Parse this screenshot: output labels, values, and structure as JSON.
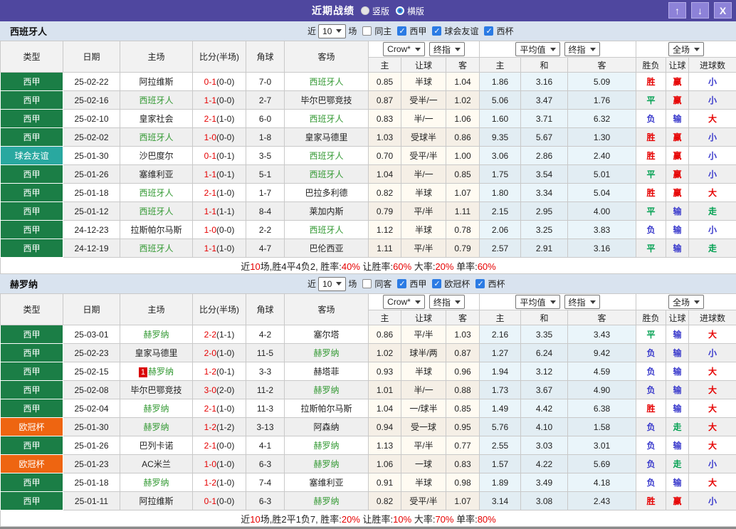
{
  "titlebar": {
    "title": "近期战绩",
    "radio_vertical": {
      "label": "竖版",
      "selected": true
    },
    "radio_horizontal": {
      "label": "横版",
      "selected": false
    },
    "icons": {
      "up": "↑",
      "down": "↓",
      "close": "X"
    }
  },
  "columns": {
    "type": "类型",
    "date": "日期",
    "home": "主场",
    "score": "比分(半场)",
    "corner": "角球",
    "away": "客场",
    "crow_home": "主",
    "crow_handicap": "让球",
    "crow_away": "客",
    "avg_home": "主",
    "avg_draw": "和",
    "avg_away": "客",
    "result": "胜负",
    "handicap_result": "让球",
    "goals": "进球数"
  },
  "dropdowns": {
    "bookmaker": "Crow*",
    "final_index": "终指",
    "average": "平均值",
    "fulltime": "全场"
  },
  "filter_labels": {
    "near": "近",
    "matches": "场"
  },
  "tables": [
    {
      "team": "西班牙人",
      "filter": {
        "count": "10",
        "same": {
          "label": "同主",
          "checked": false
        },
        "leagues": [
          {
            "label": "西甲",
            "checked": true
          },
          {
            "label": "球会友谊",
            "checked": true
          },
          {
            "label": "西杯",
            "checked": true
          }
        ]
      },
      "rows": [
        {
          "type": "西甲",
          "tc": "green",
          "date": "25-02-22",
          "home": "阿拉维斯",
          "hg": false,
          "hb": "",
          "score": "0-1",
          "half": "(0-0)",
          "corner": "7-0",
          "away": "西班牙人",
          "ag": true,
          "crow": [
            "0.85",
            "半球",
            "1.04"
          ],
          "avg": [
            "1.86",
            "3.16",
            "5.09"
          ],
          "res": [
            [
              "胜",
              "r"
            ],
            [
              "赢",
              "r"
            ],
            [
              "小",
              "b"
            ]
          ]
        },
        {
          "type": "西甲",
          "tc": "green",
          "date": "25-02-16",
          "home": "西班牙人",
          "hg": true,
          "hb": "",
          "score": "1-1",
          "half": "(0-0)",
          "corner": "2-7",
          "away": "毕尔巴鄂竞技",
          "ag": false,
          "crow": [
            "0.87",
            "受半/一",
            "1.02"
          ],
          "avg": [
            "5.06",
            "3.47",
            "1.76"
          ],
          "res": [
            [
              "平",
              "g"
            ],
            [
              "赢",
              "r"
            ],
            [
              "小",
              "b"
            ]
          ]
        },
        {
          "type": "西甲",
          "tc": "green",
          "date": "25-02-10",
          "home": "皇家社会",
          "hg": false,
          "hb": "",
          "score": "2-1",
          "half": "(1-0)",
          "corner": "6-0",
          "away": "西班牙人",
          "ag": true,
          "crow": [
            "0.83",
            "半/一",
            "1.06"
          ],
          "avg": [
            "1.60",
            "3.71",
            "6.32"
          ],
          "res": [
            [
              "负",
              "b"
            ],
            [
              "输",
              "b"
            ],
            [
              "大",
              "r"
            ]
          ]
        },
        {
          "type": "西甲",
          "tc": "green",
          "date": "25-02-02",
          "home": "西班牙人",
          "hg": true,
          "hb": "",
          "score": "1-0",
          "half": "(0-0)",
          "corner": "1-8",
          "away": "皇家马德里",
          "ag": false,
          "crow": [
            "1.03",
            "受球半",
            "0.86"
          ],
          "avg": [
            "9.35",
            "5.67",
            "1.30"
          ],
          "res": [
            [
              "胜",
              "r"
            ],
            [
              "赢",
              "r"
            ],
            [
              "小",
              "b"
            ]
          ]
        },
        {
          "type": "球会友谊",
          "tc": "teal",
          "date": "25-01-30",
          "home": "沙巴度尔",
          "hg": false,
          "hb": "",
          "score": "0-1",
          "half": "(0-1)",
          "corner": "3-5",
          "away": "西班牙人",
          "ag": true,
          "crow": [
            "0.70",
            "受平/半",
            "1.00"
          ],
          "avg": [
            "3.06",
            "2.86",
            "2.40"
          ],
          "res": [
            [
              "胜",
              "r"
            ],
            [
              "赢",
              "r"
            ],
            [
              "小",
              "b"
            ]
          ]
        },
        {
          "type": "西甲",
          "tc": "green",
          "date": "25-01-26",
          "home": "塞维利亚",
          "hg": false,
          "hb": "",
          "score": "1-1",
          "half": "(0-1)",
          "corner": "5-1",
          "away": "西班牙人",
          "ag": true,
          "crow": [
            "1.04",
            "半/一",
            "0.85"
          ],
          "avg": [
            "1.75",
            "3.54",
            "5.01"
          ],
          "res": [
            [
              "平",
              "g"
            ],
            [
              "赢",
              "r"
            ],
            [
              "小",
              "b"
            ]
          ]
        },
        {
          "type": "西甲",
          "tc": "green",
          "date": "25-01-18",
          "home": "西班牙人",
          "hg": true,
          "hb": "",
          "score": "2-1",
          "half": "(1-0)",
          "corner": "1-7",
          "away": "巴拉多利德",
          "ag": false,
          "crow": [
            "0.82",
            "半球",
            "1.07"
          ],
          "avg": [
            "1.80",
            "3.34",
            "5.04"
          ],
          "res": [
            [
              "胜",
              "r"
            ],
            [
              "赢",
              "r"
            ],
            [
              "大",
              "r"
            ]
          ]
        },
        {
          "type": "西甲",
          "tc": "green",
          "date": "25-01-12",
          "home": "西班牙人",
          "hg": true,
          "hb": "",
          "score": "1-1",
          "half": "(1-1)",
          "corner": "8-4",
          "away": "莱加内斯",
          "ag": false,
          "crow": [
            "0.79",
            "平/半",
            "1.11"
          ],
          "avg": [
            "2.15",
            "2.95",
            "4.00"
          ],
          "res": [
            [
              "平",
              "g"
            ],
            [
              "输",
              "b"
            ],
            [
              "走",
              "g"
            ]
          ]
        },
        {
          "type": "西甲",
          "tc": "green",
          "date": "24-12-23",
          "home": "拉斯帕尔马斯",
          "hg": false,
          "hb": "",
          "score": "1-0",
          "half": "(0-0)",
          "corner": "2-2",
          "away": "西班牙人",
          "ag": true,
          "crow": [
            "1.12",
            "半球",
            "0.78"
          ],
          "avg": [
            "2.06",
            "3.25",
            "3.83"
          ],
          "res": [
            [
              "负",
              "b"
            ],
            [
              "输",
              "b"
            ],
            [
              "小",
              "b"
            ]
          ]
        },
        {
          "type": "西甲",
          "tc": "green",
          "date": "24-12-19",
          "home": "西班牙人",
          "hg": true,
          "hb": "",
          "score": "1-1",
          "half": "(1-0)",
          "corner": "4-7",
          "away": "巴伦西亚",
          "ag": false,
          "crow": [
            "1.11",
            "平/半",
            "0.79"
          ],
          "avg": [
            "2.57",
            "2.91",
            "3.16"
          ],
          "res": [
            [
              "平",
              "g"
            ],
            [
              "输",
              "b"
            ],
            [
              "走",
              "g"
            ]
          ]
        }
      ],
      "summary": [
        [
          "近",
          "k"
        ],
        [
          "10",
          "r"
        ],
        [
          "场,胜4平4负2, 胜率:",
          "k"
        ],
        [
          "40%",
          "r"
        ],
        [
          " 让胜率:",
          "k"
        ],
        [
          "60%",
          "r"
        ],
        [
          " 大率:",
          "k"
        ],
        [
          "20%",
          "r"
        ],
        [
          " 单率:",
          "k"
        ],
        [
          "60%",
          "r"
        ]
      ]
    },
    {
      "team": "赫罗纳",
      "filter": {
        "count": "10",
        "same": {
          "label": "同客",
          "checked": false
        },
        "leagues": [
          {
            "label": "西甲",
            "checked": true
          },
          {
            "label": "欧冠杯",
            "checked": true
          },
          {
            "label": "西杯",
            "checked": true
          }
        ]
      },
      "rows": [
        {
          "type": "西甲",
          "tc": "green",
          "date": "25-03-01",
          "home": "赫罗纳",
          "hg": true,
          "hb": "",
          "score": "2-2",
          "half": "(1-1)",
          "corner": "4-2",
          "away": "塞尔塔",
          "ag": false,
          "crow": [
            "0.86",
            "平/半",
            "1.03"
          ],
          "avg": [
            "2.16",
            "3.35",
            "3.43"
          ],
          "res": [
            [
              "平",
              "g"
            ],
            [
              "输",
              "b"
            ],
            [
              "大",
              "r"
            ]
          ]
        },
        {
          "type": "西甲",
          "tc": "green",
          "date": "25-02-23",
          "home": "皇家马德里",
          "hg": false,
          "hb": "",
          "score": "2-0",
          "half": "(1-0)",
          "corner": "11-5",
          "away": "赫罗纳",
          "ag": true,
          "crow": [
            "1.02",
            "球半/两",
            "0.87"
          ],
          "avg": [
            "1.27",
            "6.24",
            "9.42"
          ],
          "res": [
            [
              "负",
              "b"
            ],
            [
              "输",
              "b"
            ],
            [
              "小",
              "b"
            ]
          ]
        },
        {
          "type": "西甲",
          "tc": "green",
          "date": "25-02-15",
          "home": "赫罗纳",
          "hg": true,
          "hb": "1",
          "score": "1-2",
          "half": "(0-1)",
          "corner": "3-3",
          "away": "赫塔菲",
          "ag": false,
          "crow": [
            "0.93",
            "半球",
            "0.96"
          ],
          "avg": [
            "1.94",
            "3.12",
            "4.59"
          ],
          "res": [
            [
              "负",
              "b"
            ],
            [
              "输",
              "b"
            ],
            [
              "大",
              "r"
            ]
          ]
        },
        {
          "type": "西甲",
          "tc": "green",
          "date": "25-02-08",
          "home": "毕尔巴鄂竞技",
          "hg": false,
          "hb": "",
          "score": "3-0",
          "half": "(2-0)",
          "corner": "11-2",
          "away": "赫罗纳",
          "ag": true,
          "crow": [
            "1.01",
            "半/一",
            "0.88"
          ],
          "avg": [
            "1.73",
            "3.67",
            "4.90"
          ],
          "res": [
            [
              "负",
              "b"
            ],
            [
              "输",
              "b"
            ],
            [
              "大",
              "r"
            ]
          ]
        },
        {
          "type": "西甲",
          "tc": "green",
          "date": "25-02-04",
          "home": "赫罗纳",
          "hg": true,
          "hb": "",
          "score": "2-1",
          "half": "(1-0)",
          "corner": "11-3",
          "away": "拉斯帕尔马斯",
          "ag": false,
          "crow": [
            "1.04",
            "一/球半",
            "0.85"
          ],
          "avg": [
            "1.49",
            "4.42",
            "6.38"
          ],
          "res": [
            [
              "胜",
              "r"
            ],
            [
              "输",
              "b"
            ],
            [
              "大",
              "r"
            ]
          ]
        },
        {
          "type": "欧冠杯",
          "tc": "orange",
          "date": "25-01-30",
          "home": "赫罗纳",
          "hg": true,
          "hb": "",
          "score": "1-2",
          "half": "(1-2)",
          "corner": "3-13",
          "away": "阿森纳",
          "ag": false,
          "crow": [
            "0.94",
            "受一球",
            "0.95"
          ],
          "avg": [
            "5.76",
            "4.10",
            "1.58"
          ],
          "res": [
            [
              "负",
              "b"
            ],
            [
              "走",
              "g"
            ],
            [
              "大",
              "r"
            ]
          ]
        },
        {
          "type": "西甲",
          "tc": "green",
          "date": "25-01-26",
          "home": "巴列卡诺",
          "hg": false,
          "hb": "",
          "score": "2-1",
          "half": "(0-0)",
          "corner": "4-1",
          "away": "赫罗纳",
          "ag": true,
          "crow": [
            "1.13",
            "平/半",
            "0.77"
          ],
          "avg": [
            "2.55",
            "3.03",
            "3.01"
          ],
          "res": [
            [
              "负",
              "b"
            ],
            [
              "输",
              "b"
            ],
            [
              "大",
              "r"
            ]
          ]
        },
        {
          "type": "欧冠杯",
          "tc": "orange",
          "date": "25-01-23",
          "home": "AC米兰",
          "hg": false,
          "hb": "",
          "score": "1-0",
          "half": "(1-0)",
          "corner": "6-3",
          "away": "赫罗纳",
          "ag": true,
          "crow": [
            "1.06",
            "一球",
            "0.83"
          ],
          "avg": [
            "1.57",
            "4.22",
            "5.69"
          ],
          "res": [
            [
              "负",
              "b"
            ],
            [
              "走",
              "g"
            ],
            [
              "小",
              "b"
            ]
          ]
        },
        {
          "type": "西甲",
          "tc": "green",
          "date": "25-01-18",
          "home": "赫罗纳",
          "hg": true,
          "hb": "",
          "score": "1-2",
          "half": "(1-0)",
          "corner": "7-4",
          "away": "塞维利亚",
          "ag": false,
          "crow": [
            "0.91",
            "半球",
            "0.98"
          ],
          "avg": [
            "1.89",
            "3.49",
            "4.18"
          ],
          "res": [
            [
              "负",
              "b"
            ],
            [
              "输",
              "b"
            ],
            [
              "大",
              "r"
            ]
          ]
        },
        {
          "type": "西甲",
          "tc": "green",
          "date": "25-01-11",
          "home": "阿拉维斯",
          "hg": false,
          "hb": "",
          "score": "0-1",
          "half": "(0-0)",
          "corner": "6-3",
          "away": "赫罗纳",
          "ag": true,
          "crow": [
            "0.82",
            "受平/半",
            "1.07"
          ],
          "avg": [
            "3.14",
            "3.08",
            "2.43"
          ],
          "res": [
            [
              "胜",
              "r"
            ],
            [
              "赢",
              "r"
            ],
            [
              "小",
              "b"
            ]
          ]
        }
      ],
      "summary": [
        [
          "近",
          "k"
        ],
        [
          "10",
          "r"
        ],
        [
          "场,胜2平1负7, 胜率:",
          "k"
        ],
        [
          "20%",
          "r"
        ],
        [
          " 让胜率:",
          "k"
        ],
        [
          "10%",
          "r"
        ],
        [
          " 大率:",
          "k"
        ],
        [
          "70%",
          "r"
        ],
        [
          " 单率:",
          "k"
        ],
        [
          "80%",
          "r"
        ]
      ]
    }
  ]
}
